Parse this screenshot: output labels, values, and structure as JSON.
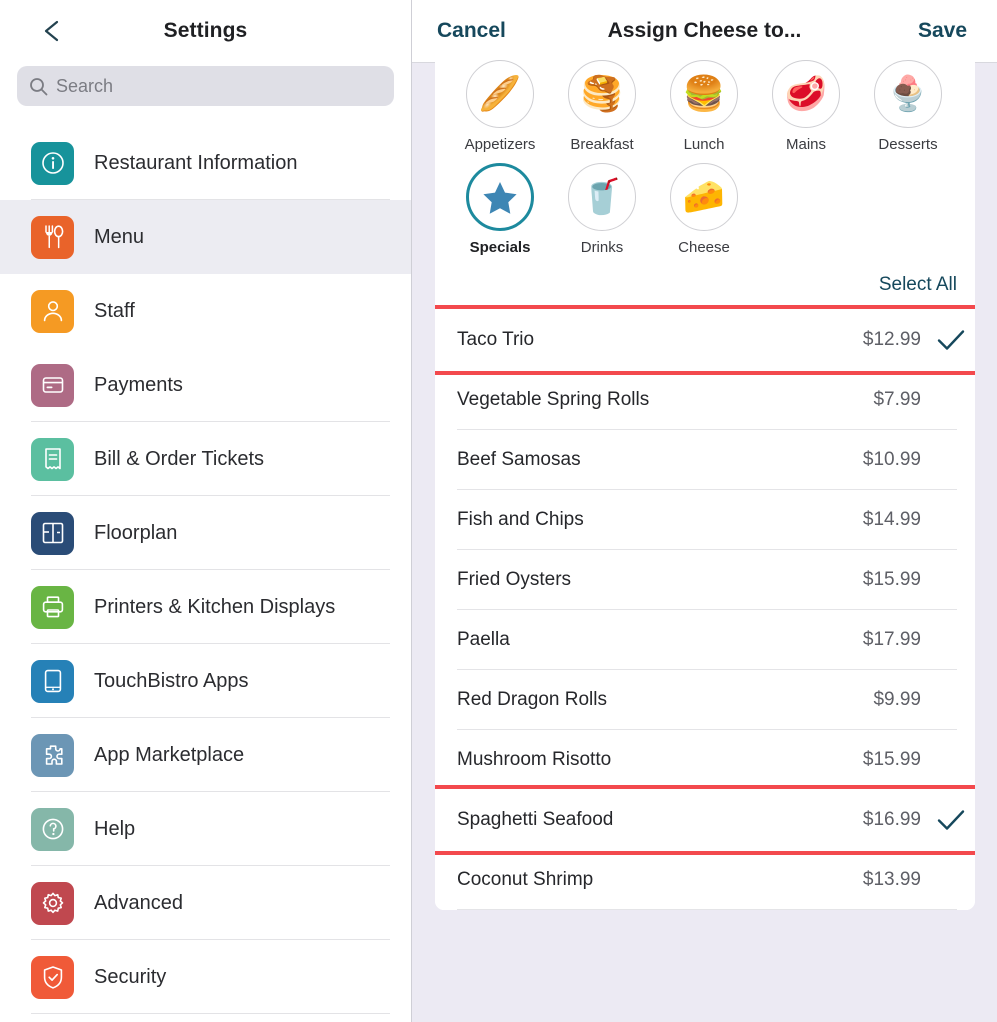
{
  "sidebar": {
    "back_icon": "chevron-left-icon",
    "title": "Settings",
    "search": {
      "placeholder": "Search",
      "value": "",
      "icon": "search-icon"
    },
    "items": [
      {
        "label": "Restaurant Information",
        "icon": "info-icon",
        "color": "#17939B",
        "selected": false
      },
      {
        "label": "Menu",
        "icon": "cutlery-icon",
        "color": "#E9632A",
        "selected": true
      },
      {
        "label": "Staff",
        "icon": "person-icon",
        "color": "#F59A23",
        "selected": false
      },
      {
        "label": "Payments",
        "icon": "credit-card-icon",
        "color": "#AE6B85",
        "selected": false
      },
      {
        "label": "Bill & Order Tickets",
        "icon": "receipt-icon",
        "color": "#5BBFA0",
        "selected": false
      },
      {
        "label": "Floorplan",
        "icon": "floorplan-icon",
        "color": "#2A4C77",
        "selected": false
      },
      {
        "label": "Printers & Kitchen Displays",
        "icon": "printer-icon",
        "color": "#69B544",
        "selected": false
      },
      {
        "label": "TouchBistro Apps",
        "icon": "tablet-icon",
        "color": "#2681B7",
        "selected": false
      },
      {
        "label": "App Marketplace",
        "icon": "puzzle-icon",
        "color": "#6C96B5",
        "selected": false
      },
      {
        "label": "Help",
        "icon": "question-icon",
        "color": "#85B7A9",
        "selected": false
      },
      {
        "label": "Advanced",
        "icon": "gear-icon",
        "color": "#C0484F",
        "selected": false
      },
      {
        "label": "Security",
        "icon": "shield-check-icon",
        "color": "#F05A38",
        "selected": false
      }
    ]
  },
  "modal": {
    "cancel_label": "Cancel",
    "title": "Assign Cheese to...",
    "save_label": "Save",
    "select_all_label": "Select All",
    "highlight_color": "#F3494D",
    "accent_color": "#16485C",
    "categories": [
      {
        "label": "Appetizers",
        "icon": "bread-icon",
        "glyph": "🥖",
        "active": false
      },
      {
        "label": "Breakfast",
        "icon": "pancakes-icon",
        "glyph": "🥞",
        "active": false
      },
      {
        "label": "Lunch",
        "icon": "lunch-combo-icon",
        "glyph": "🍔",
        "active": false
      },
      {
        "label": "Mains",
        "icon": "steak-icon",
        "glyph": "🥩",
        "active": false
      },
      {
        "label": "Desserts",
        "icon": "ice-cream-icon",
        "glyph": "🍨",
        "active": false
      },
      {
        "label": "Specials",
        "icon": "star-icon",
        "glyph": "★",
        "active": true
      },
      {
        "label": "Drinks",
        "icon": "cocktail-icon",
        "glyph": "🥤",
        "active": false
      },
      {
        "label": "Cheese",
        "icon": "cheese-wedge-icon",
        "glyph": "🧀",
        "active": false
      }
    ],
    "items": [
      {
        "name": "Taco Trio",
        "price": "$12.99",
        "checked": true,
        "highlighted": true
      },
      {
        "name": "Vegetable Spring Rolls",
        "price": "$7.99",
        "checked": false,
        "highlighted": false
      },
      {
        "name": "Beef Samosas",
        "price": "$10.99",
        "checked": false,
        "highlighted": false
      },
      {
        "name": "Fish and Chips",
        "price": "$14.99",
        "checked": false,
        "highlighted": false
      },
      {
        "name": "Fried Oysters",
        "price": "$15.99",
        "checked": false,
        "highlighted": false
      },
      {
        "name": "Paella",
        "price": "$17.99",
        "checked": false,
        "highlighted": false
      },
      {
        "name": "Red Dragon Rolls",
        "price": "$9.99",
        "checked": false,
        "highlighted": false
      },
      {
        "name": "Mushroom Risotto",
        "price": "$15.99",
        "checked": false,
        "highlighted": false
      },
      {
        "name": "Spaghetti Seafood",
        "price": "$16.99",
        "checked": true,
        "highlighted": true
      },
      {
        "name": "Coconut Shrimp",
        "price": "$13.99",
        "checked": false,
        "highlighted": false
      }
    ]
  }
}
